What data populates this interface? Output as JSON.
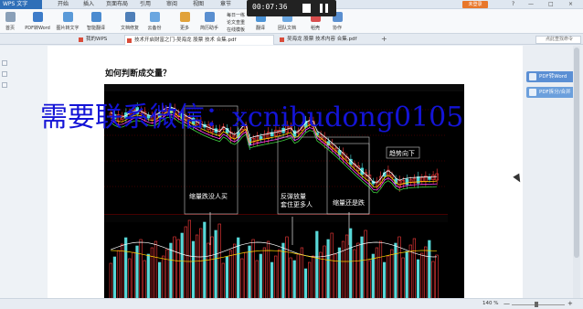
{
  "app": {
    "badge": "WPS 文字",
    "menu": [
      "开始",
      "插入",
      "页面布局",
      "引用",
      "审阅",
      "视图",
      "章节"
    ],
    "login": "未登录",
    "window_controls": [
      "?",
      "—",
      "□",
      "×"
    ]
  },
  "timer": {
    "time": "00:07:36"
  },
  "ribbon": {
    "buttons": [
      {
        "label": "首页",
        "icon": "home-icon",
        "color": "#8aa0b8"
      },
      {
        "label": "PDF转Word",
        "icon": "pdf-word-icon",
        "color": "#3d7cc9"
      },
      {
        "label": "图片转文字",
        "icon": "image-text-icon",
        "color": "#5a9ad8"
      },
      {
        "label": "智能翻译",
        "icon": "translate-icon",
        "color": "#4a8bd0"
      },
      {
        "label": "文档修复",
        "icon": "repair-icon",
        "color": "#4f7fb8"
      },
      {
        "label": "云备份",
        "icon": "cloud-backup-icon",
        "color": "#6aa6e0"
      },
      {
        "label": "更多",
        "icon": "more-icon",
        "color": "#e1a23a"
      },
      {
        "label": "简历助手",
        "icon": "resume-icon",
        "color": "#5a8fd0"
      },
      {
        "label": "翻译",
        "icon": "translate2-icon",
        "color": "#4b93d6"
      },
      {
        "label": "团队文档",
        "icon": "team-doc-icon",
        "color": "#6aa6e0"
      },
      {
        "label": "稻壳",
        "icon": "shell-icon",
        "color": "#d84e4e"
      },
      {
        "label": "协作",
        "icon": "collab-icon",
        "color": "#5a8fd0"
      }
    ],
    "small": [
      "每日一练",
      "论文查重",
      "在线模板"
    ]
  },
  "tabs": [
    {
      "label": "我的WPS",
      "active": false
    },
    {
      "label": "技术开启财富之门-吴海龙 股票 技术 合集.pdf",
      "active": true
    },
    {
      "label": "吴海龙 股票 技术内容 合集.pdf",
      "active": false
    }
  ],
  "search_placeholder": "点此查找命令",
  "document": {
    "heading": "如何判断成交量？"
  },
  "chart_data": {
    "type": "candlestick-with-volume",
    "annotations": [
      "缩量跌没人买",
      "反弹放量 套住更多人",
      "缩量还是跌",
      "趋势向下"
    ]
  },
  "watermark": "需要联系微信：xcnibudong0105",
  "right_pane": {
    "buttons": [
      {
        "label": "PDF转Word",
        "color": "#5b8fd4"
      },
      {
        "label": "PDF拆分/合并",
        "color": "#6b9fdc"
      }
    ]
  },
  "status": {
    "zoom": "140 %",
    "minus": "—",
    "plus": "+"
  }
}
